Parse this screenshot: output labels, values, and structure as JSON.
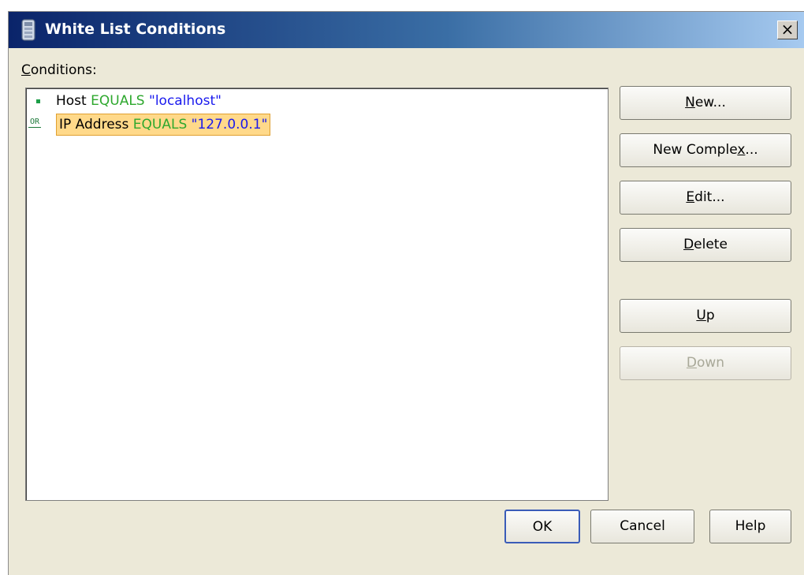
{
  "window": {
    "title": "White List Conditions",
    "close_label": "×"
  },
  "conditions_label": {
    "accel": "C",
    "rest": "onditions:"
  },
  "conditions": [
    {
      "connector": "",
      "field": "Host",
      "operator": "EQUALS",
      "value": "\"localhost\"",
      "selected": false
    },
    {
      "connector": "OR",
      "field": "IP Address",
      "operator": "EQUALS",
      "value": "\"127.0.0.1\"",
      "selected": true
    }
  ],
  "buttons": {
    "new": {
      "accel": "N",
      "rest": "ew..."
    },
    "new_complex": {
      "pre": "New Comple",
      "accel": "x",
      "rest": "..."
    },
    "edit": {
      "accel": "E",
      "rest": "dit..."
    },
    "delete": {
      "accel": "D",
      "rest": "elete"
    },
    "up": {
      "accel": "U",
      "rest": "p"
    },
    "down": {
      "accel": "D",
      "rest": "own",
      "disabled": true
    },
    "ok": "OK",
    "cancel": "Cancel",
    "help": "Help"
  },
  "colors": {
    "operator": "#2ea82e",
    "value": "#1a1aee",
    "selected_row": "#ffd98a"
  }
}
